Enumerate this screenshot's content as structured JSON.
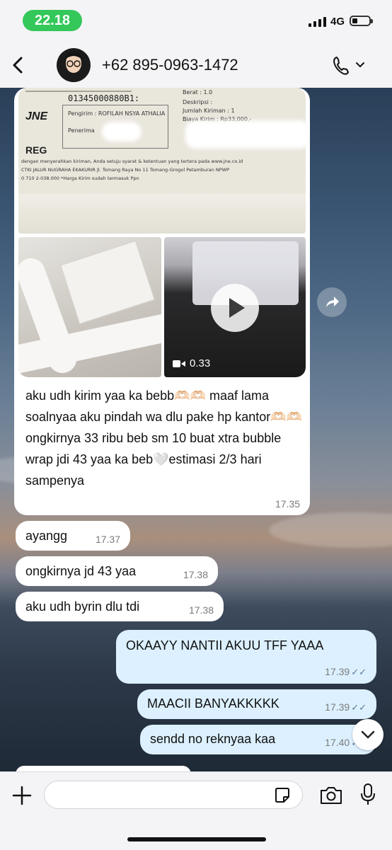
{
  "status": {
    "time": "22.18",
    "network": "4G"
  },
  "header": {
    "contact_name": "+62 895-0963-1472"
  },
  "media_message": {
    "receipt": {
      "tracking_code": "01345000880B1:",
      "carrier": "JNE",
      "service": "REG",
      "sender_label": "Pengirim : ROFILAH NSYA ATHALIA",
      "recipient_label": "Penerima",
      "weight": "Berat : 1.0",
      "description": "Deskripsi :",
      "count": "Jumlah Kiriman : 1",
      "fee": "Biaya Kirim : Rp33,000,-",
      "terms": "dengan menyerahkan kiriman, Anda setuju syarat & ketentuan yang tertera pada www.jne.co.id",
      "address": "CTKI JALUR NUGRAHA EKAKURIR Jl. Tomang Raya No 11 Tomang-Grogol Petamburan NPWP",
      "note": "0 710 2-038.000   *Harga Kirim sudah termasuk Ppn"
    },
    "video_duration": "0.33",
    "text": "aku udh kirim yaa ka bebb🫶🏻🫶🏻 maaf lama soalnyaa aku pindah wa dlu pake hp kantor🫶🏻🫶🏻ongkirnya 33 ribu beb sm 10 buat xtra bubble wrap jdi 43 yaa ka beb🤍estimasi 2/3 hari sampenya",
    "time": "17.35"
  },
  "messages": [
    {
      "text": "ayangg",
      "time": "17.37",
      "direction": "in"
    },
    {
      "text": "ongkirnya jd 43 yaa",
      "time": "17.38",
      "direction": "in"
    },
    {
      "text": "aku udh byrin dlu tdi",
      "time": "17.38",
      "direction": "in"
    },
    {
      "text": "OKAAYY NANTII AKUU TFF YAAA",
      "time": "17.39",
      "direction": "out",
      "status": "✓✓"
    },
    {
      "text": "MAACII BANYAKKKKK",
      "time": "17.39",
      "direction": "out",
      "status": "✓✓"
    },
    {
      "text": "sendd no reknyaa kaa",
      "time": "17.40",
      "direction": "out",
      "status": "✓✓"
    }
  ],
  "input": {
    "placeholder": ""
  },
  "colors": {
    "status_pill": "#34c759",
    "outgoing_bubble": "#dcf0ff",
    "incoming_bubble": "#ffffff"
  },
  "icons": [
    "back-icon",
    "phone-icon",
    "chevron-down-icon",
    "play-icon",
    "video-icon",
    "forward-icon",
    "plus-icon",
    "sticker-icon",
    "camera-icon",
    "microphone-icon",
    "scroll-down-icon"
  ]
}
